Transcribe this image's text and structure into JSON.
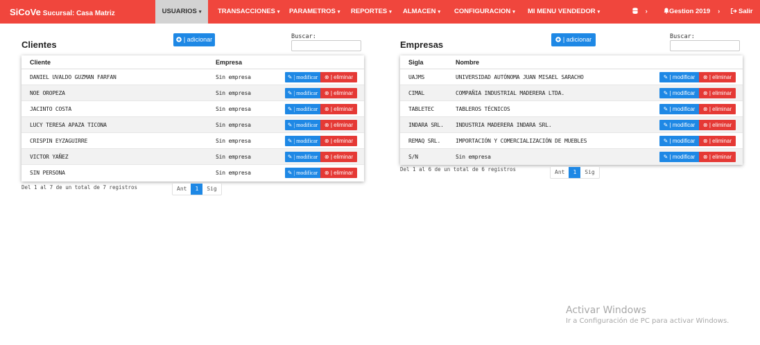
{
  "app": {
    "brand": "SiCoVe",
    "branch": "Sucursal: Casa Matriz"
  },
  "nav": {
    "items": [
      {
        "label": "USUARIOS",
        "active": true
      },
      {
        "label": "TRANSACCIONES"
      },
      {
        "label": "PARAMETROS"
      },
      {
        "label": "REPORTES"
      },
      {
        "label": "ALMACEN"
      },
      {
        "label": "CONFIGURACION"
      },
      {
        "label": "MI MENU VENDEDOR"
      }
    ],
    "caret": "▾",
    "right": {
      "chevron": "›",
      "gestion_label": "Gestion 2019",
      "salir_label": "Salir"
    }
  },
  "clientes": {
    "title": "Clientes",
    "add_label": "| adicionar",
    "search_label": "Buscar:",
    "search_value": "",
    "columns": [
      "Cliente",
      "Empresa"
    ],
    "rows": [
      {
        "cliente": "DANIEL UVALDO GUZMAN FARFAN",
        "empresa": "Sin empresa"
      },
      {
        "cliente": "NOE OROPEZA",
        "empresa": "Sin empresa"
      },
      {
        "cliente": "JACINTO COSTA",
        "empresa": "Sin empresa"
      },
      {
        "cliente": "LUCY TERESA APAZA TICONA",
        "empresa": "Sin empresa"
      },
      {
        "cliente": "CRISPIN EYZAGUIRRE",
        "empresa": "Sin empresa"
      },
      {
        "cliente": "VICTOR YAÑEZ",
        "empresa": "Sin empresa"
      },
      {
        "cliente": "SIN PERSONA",
        "empresa": "Sin empresa"
      }
    ],
    "modify_label": "| modificar",
    "delete_label": "| eliminar",
    "info": "Del 1 al 7 de un total de 7 registros",
    "pager": {
      "prev": "Ant",
      "current": "1",
      "next": "Sig"
    }
  },
  "empresas": {
    "title": "Empresas",
    "add_label": "| adicionar",
    "search_label": "Buscar:",
    "search_value": "",
    "columns": [
      "Sigla",
      "Nombre"
    ],
    "rows": [
      {
        "sigla": "UAJMS",
        "nombre": "UNIVERSIDAD AUTÓNOMA JUAN MISAEL SARACHO"
      },
      {
        "sigla": "CIMAL",
        "nombre": "COMPAÑIA INDUSTRIAL MADERERA LTDA."
      },
      {
        "sigla": "TABLETEC",
        "nombre": "TABLEROS TÉCNICOS"
      },
      {
        "sigla": "INDARA SRL.",
        "nombre": "INDUSTRIA MADERERA INDARA SRL."
      },
      {
        "sigla": "REMAQ SRL.",
        "nombre": "IMPORTACIÓN Y COMERCIALIZACIÓN DE MUEBLES"
      },
      {
        "sigla": "S/N",
        "nombre": "Sin empresa"
      }
    ],
    "modify_label": "| modificar",
    "delete_label": "| eliminar",
    "info": "Del 1 al 6 de un total de 6 registros",
    "pager": {
      "prev": "Ant",
      "current": "1",
      "next": "Sig"
    }
  },
  "watermark": {
    "line1": "Activar Windows",
    "line2": "Ir a Configuración de PC para activar Windows."
  },
  "colors": {
    "navbar": "#f0463d",
    "primary": "#1e88e5",
    "danger": "#e53935",
    "active_nav": "#d3d3d3"
  }
}
